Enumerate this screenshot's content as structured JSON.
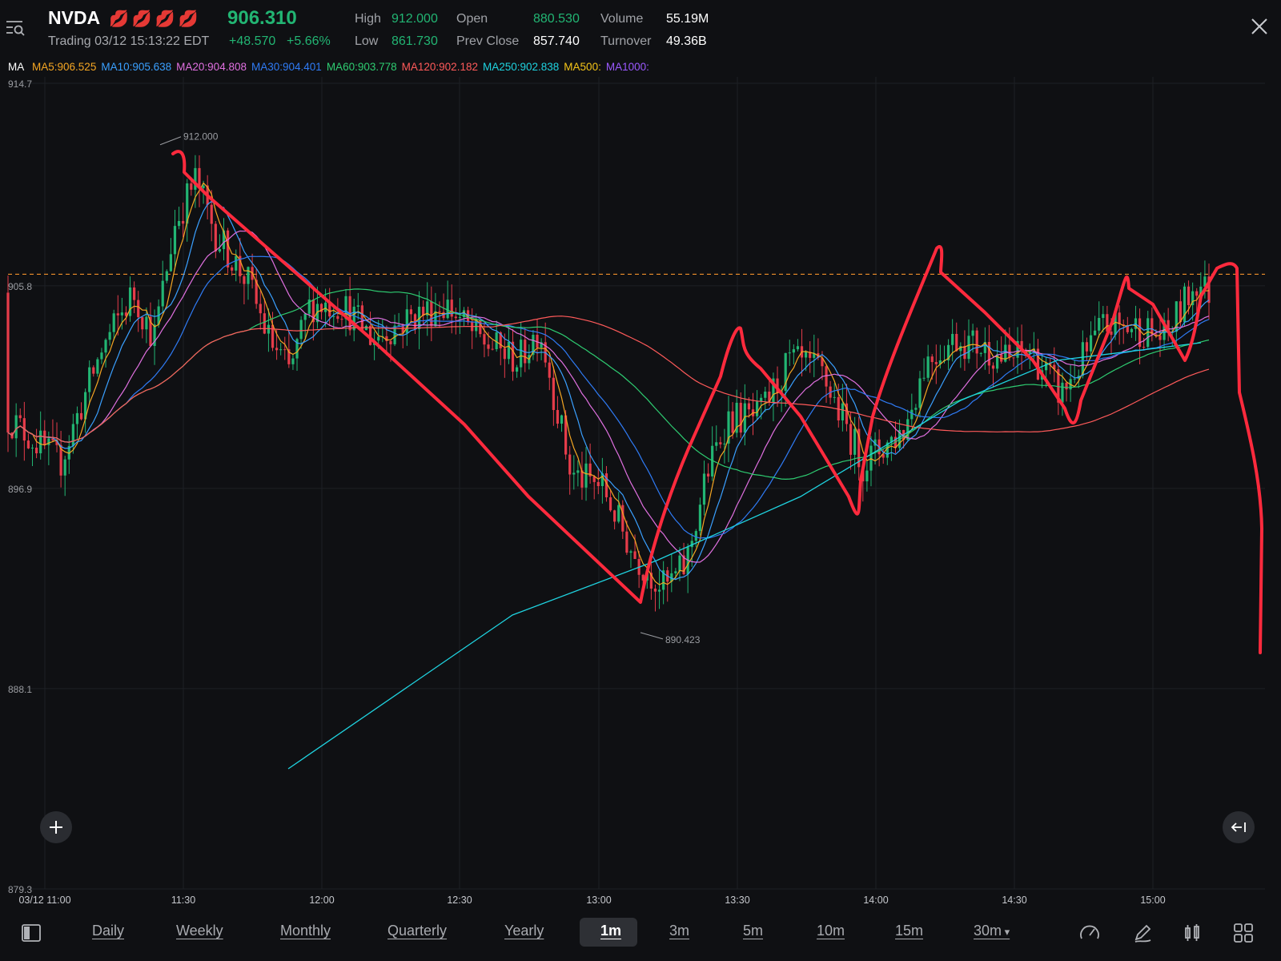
{
  "header": {
    "ticker": "NVDA",
    "emojis": "💋💋💋💋",
    "price": "906.310",
    "status_time": "Trading 03/12 15:13:22 EDT",
    "change": "+48.570",
    "change_pct": "+5.66%",
    "stats": {
      "high_label": "High",
      "high": "912.000",
      "low_label": "Low",
      "low": "861.730",
      "open_label": "Open",
      "open": "880.530",
      "prev_close_label": "Prev Close",
      "prev_close": "857.740",
      "volume_label": "Volume",
      "volume": "55.19M",
      "turnover_label": "Turnover",
      "turnover": "49.36B"
    }
  },
  "ma_bar": {
    "label": "MA",
    "items": [
      {
        "text": "MA5:906.525",
        "color": "#f5a623"
      },
      {
        "text": "MA10:905.638",
        "color": "#3aa0ff"
      },
      {
        "text": "MA20:904.808",
        "color": "#e070e0"
      },
      {
        "text": "MA30:904.401",
        "color": "#2f7bf5"
      },
      {
        "text": "MA60:903.778",
        "color": "#2ecc71"
      },
      {
        "text": "MA120:902.182",
        "color": "#ff5a5a"
      },
      {
        "text": "MA250:902.838",
        "color": "#1fd3e0"
      },
      {
        "text": "MA500:",
        "color": "#f5c518"
      },
      {
        "text": "MA1000:",
        "color": "#9b59ff"
      }
    ]
  },
  "chart_data": {
    "type": "candlestick",
    "price_axis": [
      "914.7",
      "905.8",
      "896.9",
      "888.1",
      "879.3"
    ],
    "time_axis": [
      "03/12 11:00",
      "11:30",
      "12:00",
      "12:30",
      "13:00",
      "13:30",
      "14:00",
      "14:30",
      "15:00"
    ],
    "ylim": [
      879.3,
      914.7
    ],
    "high_marker": "912.000",
    "low_marker": "890.423",
    "current_price": 906.31,
    "grid": true,
    "colors": {
      "up": "#22b573",
      "down": "#e53c4a",
      "current_line": "#f0902a",
      "annotation": "#ff2a3d"
    }
  },
  "toolbar": {
    "periods": [
      "Daily",
      "Weekly",
      "Monthly",
      "Quarterly",
      "Yearly"
    ],
    "intervals": [
      "1m",
      "3m",
      "5m",
      "10m",
      "15m",
      "30m"
    ],
    "active": "1m",
    "icons": [
      "layout-toggle-icon",
      "speed-gauge-icon",
      "draw-pen-icon",
      "candle-type-icon",
      "grid-apps-icon"
    ]
  }
}
